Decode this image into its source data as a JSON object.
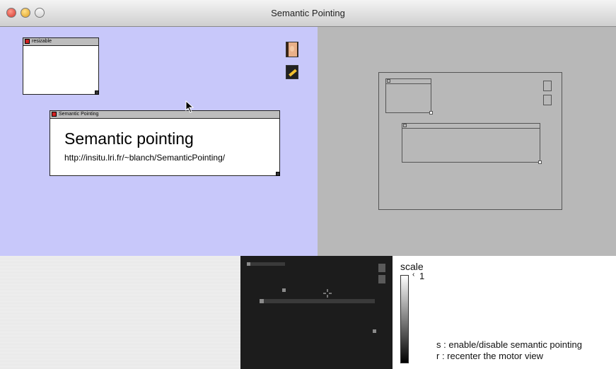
{
  "window": {
    "title": "Semantic Pointing"
  },
  "widgets": {
    "resizable_title": "resizable",
    "sp_title": "Semantic Pointing",
    "sp_heading": "Semantic pointing",
    "sp_url": "http://insitu.lri.fr/~blanch/SemanticPointing/"
  },
  "legend": {
    "scale_label": "scale",
    "scale_value": "1",
    "help_s": "s : enable/disable semantic pointing",
    "help_r": "r : recenter the motor view"
  },
  "colors": {
    "visual_space": "#c8c8fa",
    "overview": "#b8b8b8",
    "motor_space": "#1c1c1c",
    "close_box": "#d12222"
  },
  "icons": [
    "portrait-icon",
    "magic-wand-icon",
    "pointer-cursor-icon",
    "crosshair-icon"
  ]
}
